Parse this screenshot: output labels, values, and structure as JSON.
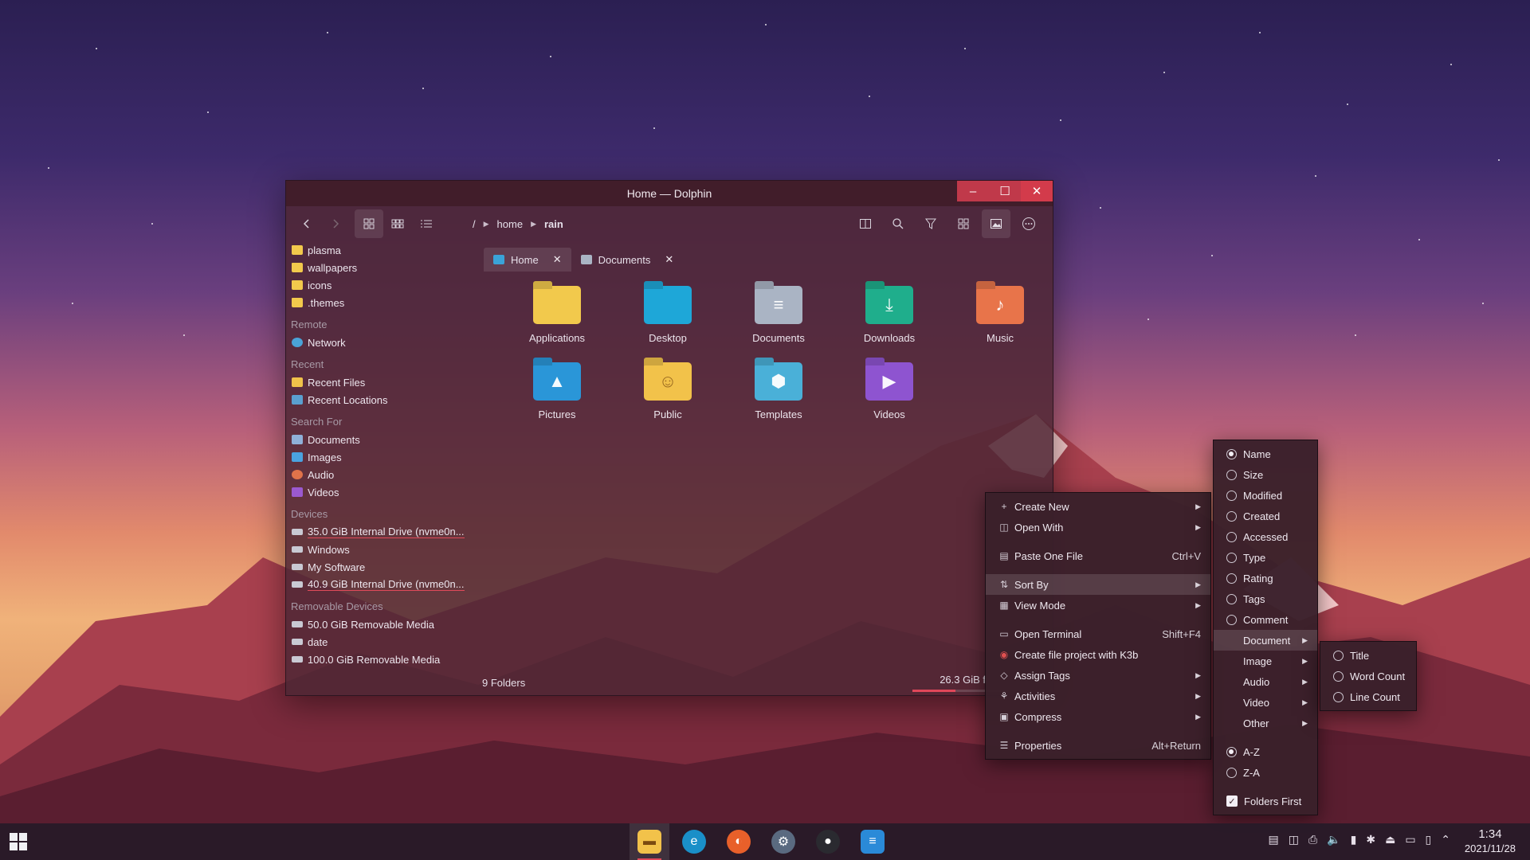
{
  "window": {
    "title": "Home — Dolphin",
    "min": "–",
    "max": "☐",
    "close": "✕"
  },
  "breadcrumb": {
    "root": "/",
    "parts": [
      "home",
      "rain"
    ]
  },
  "sidebar": {
    "places": [
      "plasma",
      "wallpapers",
      "icons",
      ".themes"
    ],
    "remote_header": "Remote",
    "remote": [
      "Network"
    ],
    "recent_header": "Recent",
    "recent": [
      "Recent Files",
      "Recent Locations"
    ],
    "search_header": "Search For",
    "search": [
      "Documents",
      "Images",
      "Audio",
      "Videos"
    ],
    "devices_header": "Devices",
    "devices": [
      "35.0 GiB Internal Drive (nvme0n...",
      "Windows",
      "My Software",
      "40.9 GiB Internal Drive (nvme0n..."
    ],
    "removable_header": "Removable Devices",
    "removable": [
      "50.0 GiB Removable Media",
      "date",
      "100.0 GiB Removable Media"
    ]
  },
  "tabs": [
    {
      "label": "Home",
      "close": "✕"
    },
    {
      "label": "Documents",
      "close": "✕"
    }
  ],
  "files": [
    {
      "label": "Applications",
      "color": "#f2c94c"
    },
    {
      "label": "Desktop",
      "color": "#1ea7d8"
    },
    {
      "label": "Documents",
      "color": "#aab4c4"
    },
    {
      "label": "Downloads",
      "color": "#1fae8c"
    },
    {
      "label": "Music",
      "color": "#e8744a"
    },
    {
      "label": "Pictures",
      "color": "#2a96d8"
    },
    {
      "label": "Public",
      "color": "#f2c24a"
    },
    {
      "label": "Templates",
      "color": "#4ab0d8"
    },
    {
      "label": "Videos",
      "color": "#8e54d0"
    }
  ],
  "status": {
    "folders": "9 Folders",
    "free": "26.3 GiB f",
    "free_fraction": 0.45
  },
  "context_menu": {
    "create_new": "Create New",
    "open_with": "Open With",
    "paste": "Paste One File",
    "paste_short": "Ctrl+V",
    "sort_by": "Sort By",
    "view_mode": "View Mode",
    "open_terminal": "Open Terminal",
    "open_terminal_short": "Shift+F4",
    "k3b": "Create file project with K3b",
    "assign_tags": "Assign Tags",
    "activities": "Activities",
    "compress": "Compress",
    "properties": "Properties",
    "properties_short": "Alt+Return"
  },
  "sort_menu": {
    "name": "Name",
    "size": "Size",
    "modified": "Modified",
    "created": "Created",
    "accessed": "Accessed",
    "type": "Type",
    "rating": "Rating",
    "tags": "Tags",
    "comment": "Comment",
    "document": "Document",
    "image": "Image",
    "audio": "Audio",
    "video": "Video",
    "other": "Other",
    "az": "A-Z",
    "za": "Z-A",
    "folders_first": "Folders First"
  },
  "document_menu": {
    "title": "Title",
    "word_count": "Word Count",
    "line_count": "Line Count"
  },
  "taskbar": {
    "time": "1:34",
    "date": "2021/11/28"
  }
}
